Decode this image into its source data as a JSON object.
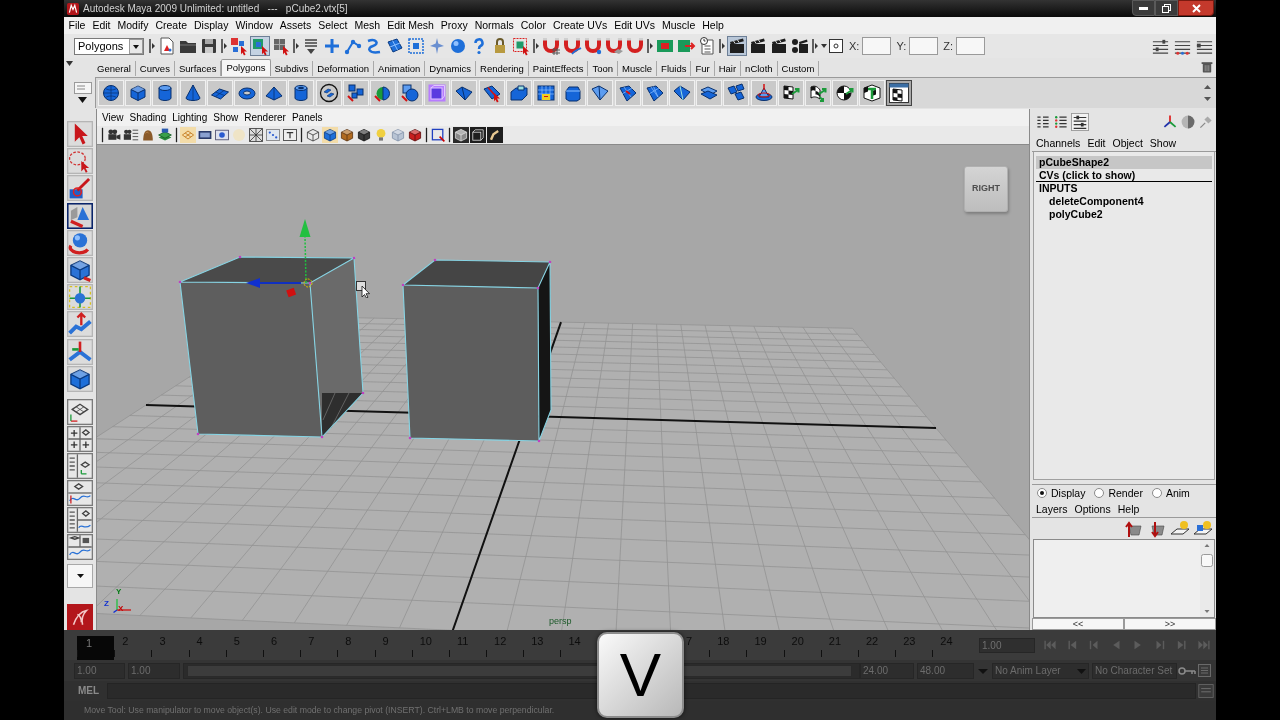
{
  "window": {
    "title": "Autodesk Maya 2009 Unlimited: untitled   ---   pCube2.vtx[5]"
  },
  "menu_bar": [
    "File",
    "Edit",
    "Modify",
    "Create",
    "Display",
    "Window",
    "Assets",
    "Select",
    "Mesh",
    "Edit Mesh",
    "Proxy",
    "Normals",
    "Color",
    "Create UVs",
    "Edit UVs",
    "Muscle",
    "Help"
  ],
  "status_line": {
    "menu_set": "Polygons",
    "coordinate_fields": [
      {
        "label": "X:"
      },
      {
        "label": "Y:"
      },
      {
        "label": "Z:"
      }
    ]
  },
  "shelf": {
    "tabs": [
      {
        "label": "General",
        "selected": false
      },
      {
        "label": "Curves",
        "selected": false
      },
      {
        "label": "Surfaces",
        "selected": false
      },
      {
        "label": "Polygons",
        "selected": true
      },
      {
        "label": "Subdivs",
        "selected": false
      },
      {
        "label": "Deformation",
        "selected": false
      },
      {
        "label": "Animation",
        "selected": false
      },
      {
        "label": "Dynamics",
        "selected": false
      },
      {
        "label": "Rendering",
        "selected": false
      },
      {
        "label": "PaintEffects",
        "selected": false
      },
      {
        "label": "Toon",
        "selected": false
      },
      {
        "label": "Muscle",
        "selected": false
      },
      {
        "label": "Fluids",
        "selected": false
      },
      {
        "label": "Fur",
        "selected": false
      },
      {
        "label": "Hair",
        "selected": false
      },
      {
        "label": "nCloth",
        "selected": false
      },
      {
        "label": "Custom",
        "selected": false
      }
    ]
  },
  "toolbox": {
    "tools": [
      {
        "kind": "select",
        "selected": false
      },
      {
        "kind": "lasso",
        "selected": false
      },
      {
        "kind": "paint_select",
        "selected": false
      },
      {
        "kind": "move",
        "selected": true
      },
      {
        "kind": "rotate",
        "selected": false
      },
      {
        "kind": "scale",
        "selected": false
      },
      {
        "kind": "universal_manipulator",
        "selected": false
      },
      {
        "kind": "soft_modification",
        "selected": false
      },
      {
        "kind": "show_manipulator",
        "selected": false
      },
      {
        "kind": "last_tool",
        "selected": false
      }
    ]
  },
  "viewport": {
    "menu": [
      "View",
      "Shading",
      "Lighting",
      "Show",
      "Renderer",
      "Panels"
    ],
    "view_cube": {
      "label": "RIGHT"
    },
    "axis_labels": [
      "Y",
      "Z",
      "X"
    ],
    "camera_label": "persp"
  },
  "channel_box": {
    "menu": [
      "Channels",
      "Edit",
      "Object",
      "Show"
    ],
    "shape": {
      "label": "pCubeShape2",
      "selected": true
    },
    "shape_rows": [
      "CVs (click to show)"
    ],
    "inputs": {
      "label": "INPUTS",
      "children": [
        {
          "label": "deleteComponent4"
        },
        {
          "label": "polyCube2"
        }
      ]
    }
  },
  "layer_editor": {
    "modes": [
      {
        "label": "Display",
        "selected": true
      },
      {
        "label": "Render",
        "selected": false
      },
      {
        "label": "Anim",
        "selected": false
      }
    ],
    "menu": [
      "Layers",
      "Options",
      "Help"
    ],
    "page_buttons": [
      "<<",
      ">>"
    ]
  },
  "time_slider": {
    "frames": [
      {
        "label": "1",
        "selected": true
      },
      {
        "label": "2",
        "selected": false
      },
      {
        "label": "3",
        "selected": false
      },
      {
        "label": "4",
        "selected": false
      },
      {
        "label": "5",
        "selected": false
      },
      {
        "label": "6",
        "selected": false
      },
      {
        "label": "7",
        "selected": false
      },
      {
        "label": "8",
        "selected": false
      },
      {
        "label": "9",
        "selected": false
      },
      {
        "label": "10",
        "selected": false
      },
      {
        "label": "11",
        "selected": false
      },
      {
        "label": "12",
        "selected": false
      },
      {
        "label": "13",
        "selected": false
      },
      {
        "label": "14",
        "selected": false
      }
    ],
    "frames_after_overlay": [
      {
        "label": "7",
        "selected": false
      },
      {
        "label": "18",
        "selected": false
      },
      {
        "label": "19",
        "selected": false
      },
      {
        "label": "20",
        "selected": false
      },
      {
        "label": "21",
        "selected": false
      },
      {
        "label": "22",
        "selected": false
      },
      {
        "label": "23",
        "selected": false
      },
      {
        "label": "24",
        "selected": false
      }
    ],
    "current_time": "1.00"
  },
  "range_slider": {
    "start_time": "1.00",
    "playback_start": "1.00",
    "playback_end": "24.00",
    "end_time": "48.00",
    "anim_layer": "No Anim Layer",
    "character_set": "No Character Set"
  },
  "command_line": {
    "language": "MEL"
  },
  "help_line": "Move Tool: Use manipulator to move object(s). Use edit mode to change pivot (INSERT).  Ctrl+LMB to move perpendicular.",
  "key_overlay": {
    "key": "V"
  }
}
